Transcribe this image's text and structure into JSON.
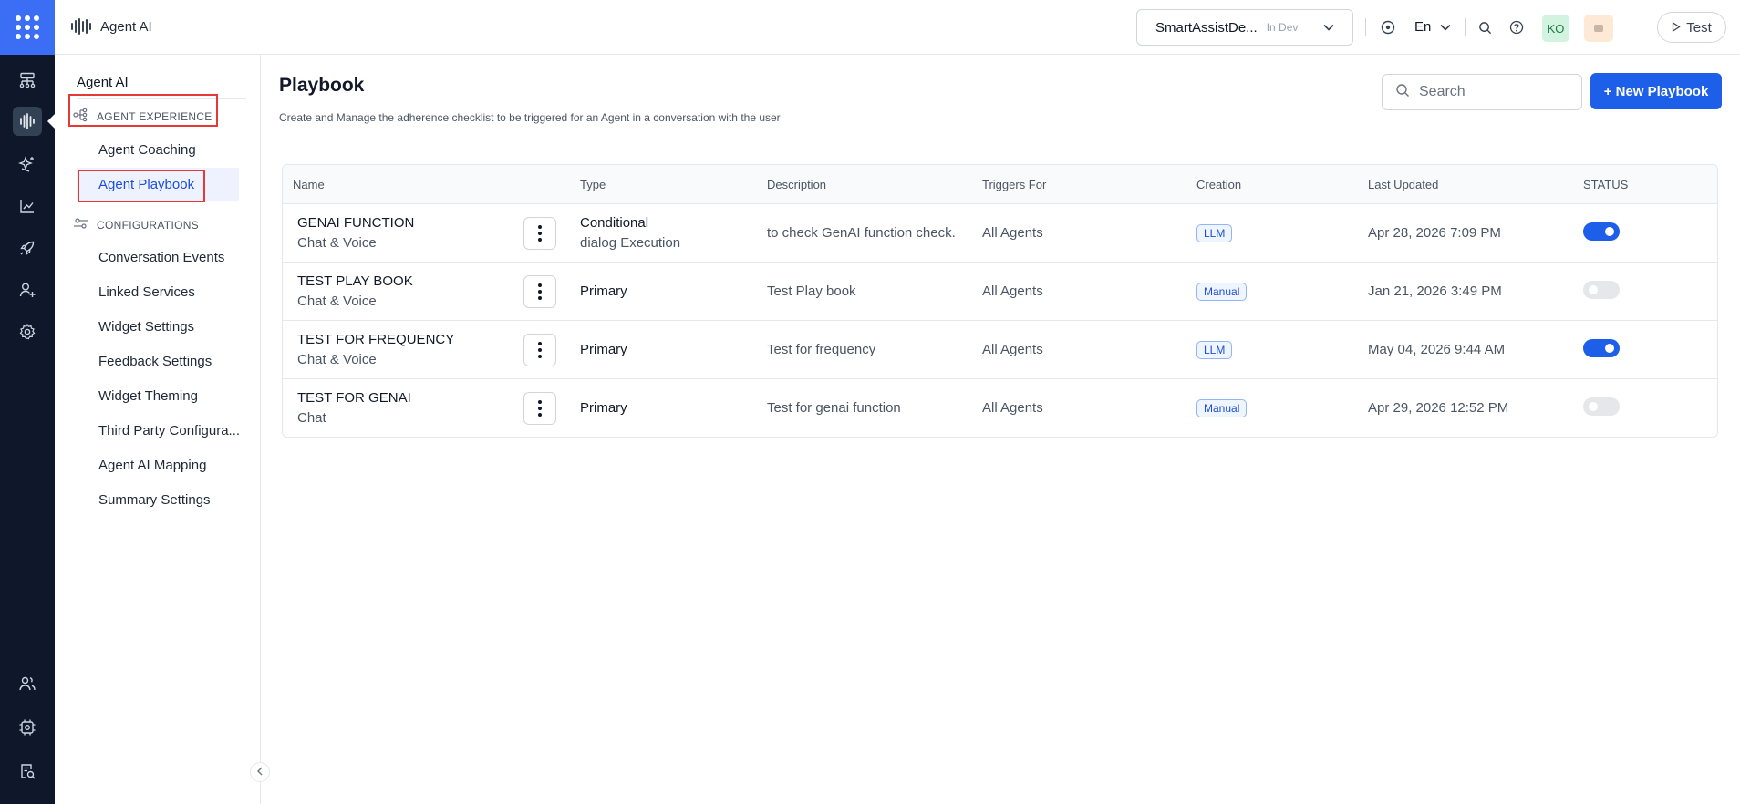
{
  "app": {
    "name": "Agent AI"
  },
  "topbar": {
    "environment": {
      "name": "SmartAssistDe...",
      "tag": "In Dev"
    },
    "language": "En",
    "avatar_initials": "KO",
    "test_label": "Test"
  },
  "rail": {
    "icons": [
      "flow-icon",
      "agent-ai-icon",
      "sparkles-icon",
      "analytics-icon",
      "rocket-icon",
      "add-user-icon",
      "settings-icon",
      "users-icon",
      "chip-settings-icon",
      "audit-log-icon"
    ]
  },
  "sidebar": {
    "title": "Agent AI",
    "sections": [
      {
        "label": "AGENT EXPERIENCE",
        "items": [
          "Agent Coaching",
          "Agent Playbook"
        ]
      },
      {
        "label": "CONFIGURATIONS",
        "items": [
          "Conversation Events",
          "Linked Services",
          "Widget Settings",
          "Feedback Settings",
          "Widget Theming",
          "Third Party Configura...",
          "Agent AI Mapping",
          "Summary Settings"
        ]
      }
    ],
    "active_item": "Agent Playbook"
  },
  "main": {
    "title": "Playbook",
    "subtitle": "Create and Manage the adherence checklist to be triggered for an Agent in a conversation with the user",
    "search_placeholder": "Search",
    "new_button_label": "+ New Playbook",
    "table": {
      "headers": [
        "Name",
        "Type",
        "Description",
        "Triggers For",
        "Creation",
        "Last Updated",
        "STATUS"
      ],
      "rows": [
        {
          "name": "GENAI FUNCTION",
          "channel": "Chat & Voice",
          "type": "Conditional",
          "type_sub": "dialog Execution",
          "description": "to check GenAI function check.",
          "triggers": "All Agents",
          "creation": "LLM",
          "updated": "Apr 28, 2026 7:09 PM",
          "status": true
        },
        {
          "name": "TEST PLAY BOOK",
          "channel": "Chat & Voice",
          "type": "Primary",
          "type_sub": "",
          "description": "Test Play book",
          "triggers": "All Agents",
          "creation": "Manual",
          "updated": "Jan 21, 2026 3:49 PM",
          "status": false
        },
        {
          "name": "TEST FOR FREQUENCY",
          "channel": "Chat & Voice",
          "type": "Primary",
          "type_sub": "",
          "description": "Test for frequency",
          "triggers": "All Agents",
          "creation": "LLM",
          "updated": "May 04, 2026 9:44 AM",
          "status": true
        },
        {
          "name": "TEST FOR GENAI",
          "channel": "Chat",
          "type": "Primary",
          "type_sub": "",
          "description": "Test for genai function",
          "triggers": "All Agents",
          "creation": "Manual",
          "updated": "Apr 29, 2026 12:52 PM",
          "status": false
        }
      ]
    }
  },
  "colors": {
    "accent": "#1d5fe8",
    "rail_bg": "#0f172a",
    "launcher_bg": "#3b6ef5",
    "highlight_box": "#e53935",
    "toggle_on": "#1d5fe8",
    "toggle_off": "#e5e7eb"
  }
}
